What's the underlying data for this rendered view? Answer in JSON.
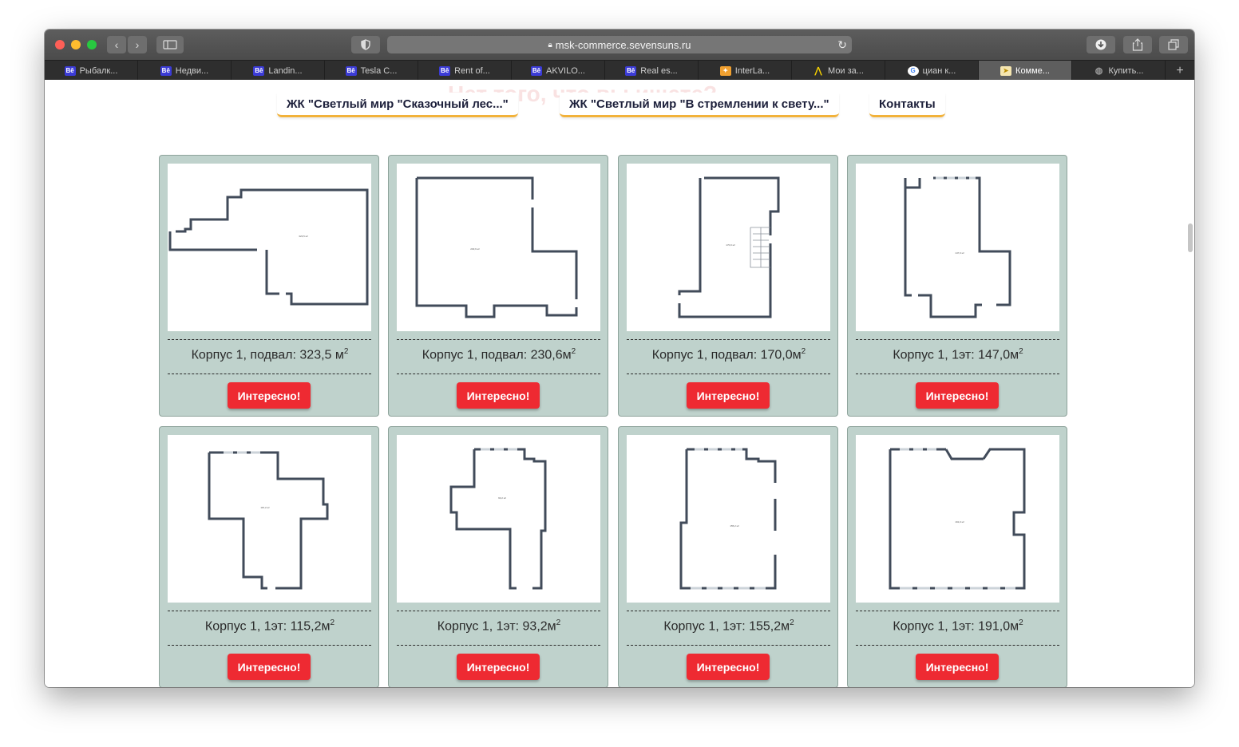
{
  "browser": {
    "url": "msk-commerce.sevensuns.ru",
    "tabs": [
      {
        "label": "Рыбалк...",
        "icon": "behance-icon"
      },
      {
        "label": "Недви...",
        "icon": "behance-icon"
      },
      {
        "label": "Landin...",
        "icon": "behance-icon"
      },
      {
        "label": "Tesla C...",
        "icon": "behance-icon"
      },
      {
        "label": "Rent of...",
        "icon": "behance-icon"
      },
      {
        "label": "AKVILO...",
        "icon": "behance-icon"
      },
      {
        "label": "Real es...",
        "icon": "behance-icon"
      },
      {
        "label": "InterLa...",
        "icon": "interlab-icon"
      },
      {
        "label": "Мои за...",
        "icon": "yandex-icon"
      },
      {
        "label": "циан к...",
        "icon": "google-icon"
      },
      {
        "label": "Комме...",
        "icon": "sevensuns-icon"
      },
      {
        "label": "Купить...",
        "icon": "globe-icon"
      }
    ],
    "new_tab": "+"
  },
  "page": {
    "ghost_heading": "Нет того, что вы ищете?",
    "nav": [
      "ЖК \"Светлый мир \"Сказочный лес...\"",
      "ЖК \"Светлый мир \"В стремлении к свету...\"",
      "Контакты"
    ],
    "cards": [
      {
        "label": "Корпус 1, подвал: 323,5 м",
        "sup": "2",
        "area": "323,5 м²",
        "button": "Интересно!"
      },
      {
        "label": "Корпус 1, подвал: 230,6м",
        "sup": "2",
        "area": "230,6 м²",
        "button": "Интересно!"
      },
      {
        "label": "Корпус 1, подвал: 170,0м",
        "sup": "2",
        "area": "170,0 м²",
        "button": "Интересно!"
      },
      {
        "label": "Корпус 1, 1эт: 147,0м",
        "sup": "2",
        "area": "147,0 м²",
        "button": "Интересно!"
      },
      {
        "label": "Корпус 1, 1эт: 115,2м",
        "sup": "2",
        "area": "115,2 м²",
        "button": "Интересно!"
      },
      {
        "label": "Корпус 1, 1эт: 93,2м",
        "sup": "2",
        "area": "93,2 м²",
        "button": "Интересно!"
      },
      {
        "label": "Корпус 1, 1эт: 155,2м",
        "sup": "2",
        "area": "155,2 м²",
        "button": "Интересно!"
      },
      {
        "label": "Корпус 1, 1эт: 191,0м",
        "sup": "2",
        "area": "191,0 м²",
        "button": "Интересно!"
      }
    ]
  }
}
